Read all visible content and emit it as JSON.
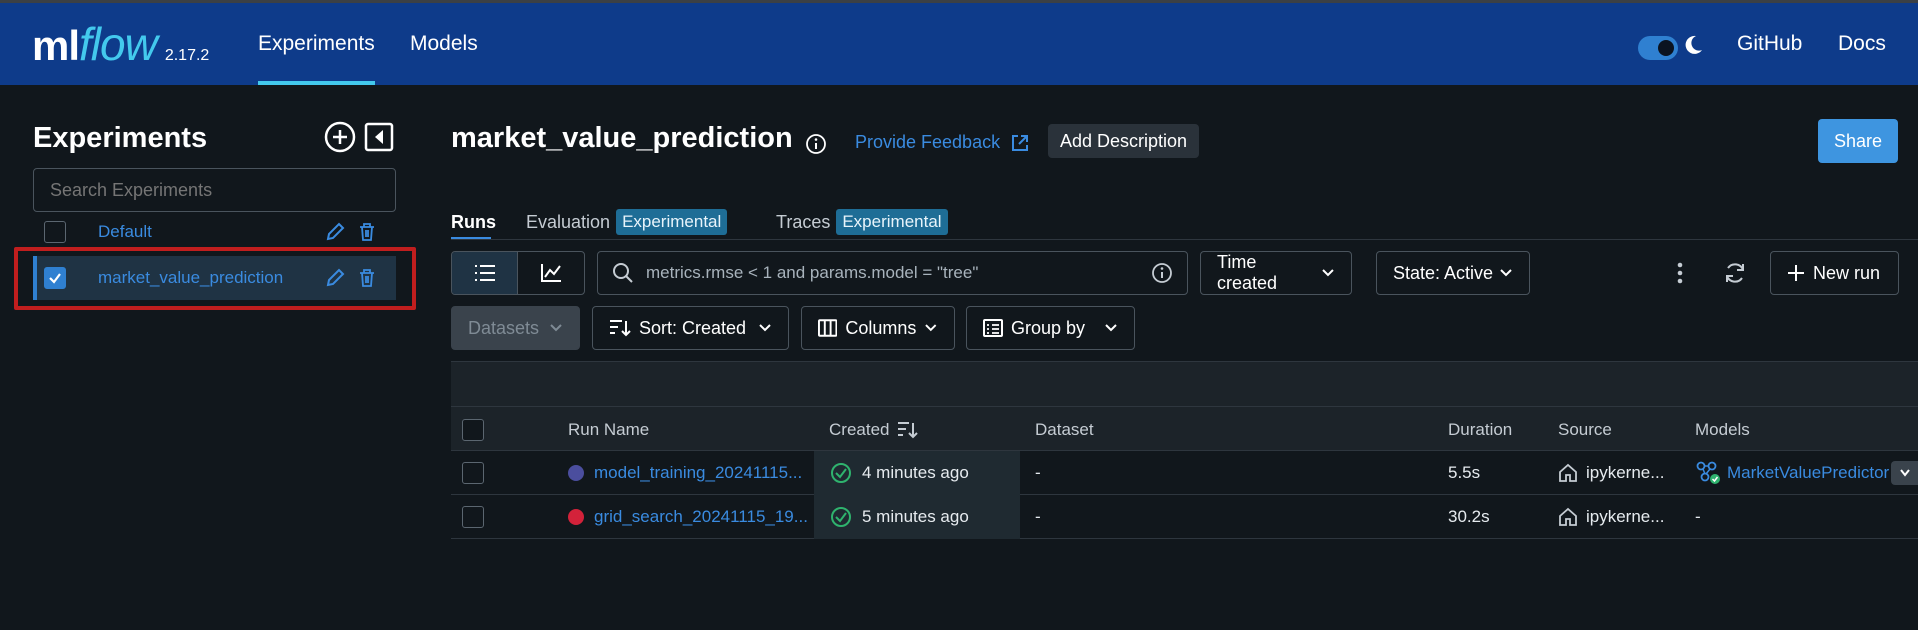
{
  "header": {
    "logo_ml": "ml",
    "logo_flow": "flow",
    "version": "2.17.2",
    "nav": [
      "Experiments",
      "Models"
    ],
    "github": "GitHub",
    "docs": "Docs",
    "dark_mode_on": true
  },
  "sidebar": {
    "title": "Experiments",
    "search_placeholder": "Search Experiments",
    "experiments": [
      {
        "name": "Default",
        "checked": false
      },
      {
        "name": "market_value_prediction",
        "checked": true
      }
    ]
  },
  "main": {
    "title": "market_value_prediction",
    "feedback": "Provide Feedback",
    "add_description": "Add Description",
    "share": "Share",
    "tabs": [
      {
        "label": "Runs",
        "badge": ""
      },
      {
        "label": "Evaluation",
        "badge": "Experimental"
      },
      {
        "label": "Traces",
        "badge": "Experimental"
      }
    ],
    "search_placeholder": "metrics.rmse < 1 and params.model = \"tree\"",
    "time_created": "Time created",
    "state": "State: Active",
    "new_run": "New run",
    "datasets": "Datasets",
    "sort": "Sort: Created",
    "columns": "Columns",
    "group_by": "Group by"
  },
  "table": {
    "headers": [
      "Run Name",
      "Created",
      "Dataset",
      "Duration",
      "Source",
      "Models"
    ],
    "rows": [
      {
        "name": "model_training_20241115...",
        "color": "#4b4e9e",
        "created": "4 minutes ago",
        "dataset": "-",
        "duration": "5.5s",
        "source": "ipykerne...",
        "model": "MarketValuePredictor"
      },
      {
        "name": "grid_search_20241115_19...",
        "color": "#d3223a",
        "created": "5 minutes ago",
        "dataset": "-",
        "duration": "30.2s",
        "source": "ipykerne...",
        "model": "-"
      }
    ]
  },
  "colors": {
    "accent": "#43c9ed",
    "header_bg": "#0e3b8a",
    "link": "#3a8be0",
    "success": "#2fb36e",
    "highlight": "#c11e1e"
  }
}
